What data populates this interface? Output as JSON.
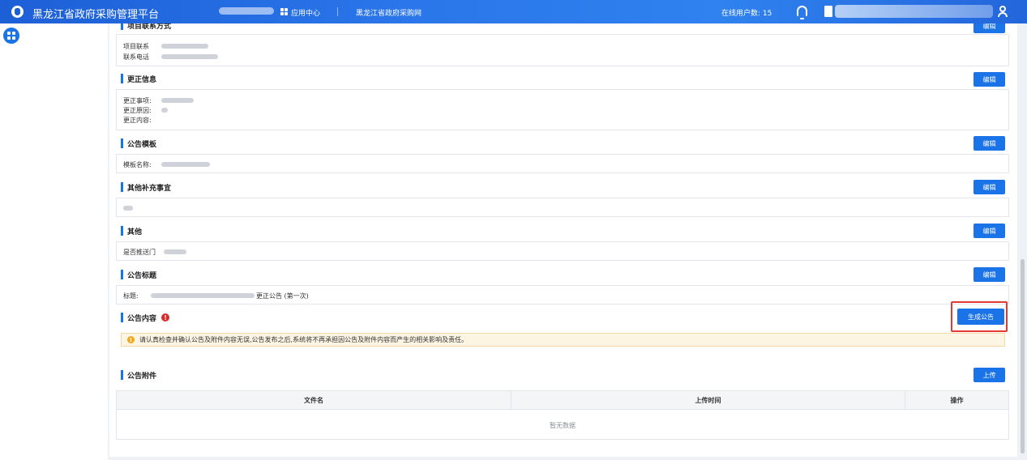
{
  "header": {
    "app_title": "黑龙江省政府采购管理平台",
    "app_center": "应用中心",
    "gov_site": "黑龙江省政府采购网",
    "online_label": "在线用户数: 15",
    "icons": [
      "shield-logo-icon",
      "apps-grid-icon",
      "bell-icon",
      "document-icon",
      "user-icon"
    ]
  },
  "sections": {
    "project_contact": {
      "title": "项目联系方式",
      "fields": [
        "项目联系",
        "联系电话"
      ],
      "edit_label": "编辑"
    },
    "correction": {
      "title": "更正信息",
      "fields": [
        "更正事项:",
        "更正原因:",
        "更正内容:"
      ],
      "edit_label": "编辑"
    },
    "template": {
      "title": "公告模板",
      "fields": [
        "模板名称:"
      ],
      "edit_label": "编辑"
    },
    "supplement": {
      "title": "其他补充事宜",
      "edit_label": "编辑"
    },
    "other": {
      "title": "其他",
      "fields": [
        "是否推送门"
      ],
      "edit_label": "编辑"
    },
    "announce_title": {
      "title": "公告标题",
      "label": "标题:",
      "suffix": "更正公告 (第一次)",
      "edit_label": "编辑"
    },
    "content": {
      "title": "公告内容",
      "warn_mark": "!",
      "generate_label": "生成公告",
      "notice_mark": "!",
      "notice": "请认真检查并确认公告及附件内容无误,公告发布之后,系统将不再承担因公告及附件内容而产生的相关影响及责任。"
    },
    "attachments": {
      "title": "公告附件",
      "upload_label": "上传",
      "columns": [
        "文件名",
        "上传时间",
        "操作"
      ],
      "empty_text": "暂无数据"
    }
  }
}
